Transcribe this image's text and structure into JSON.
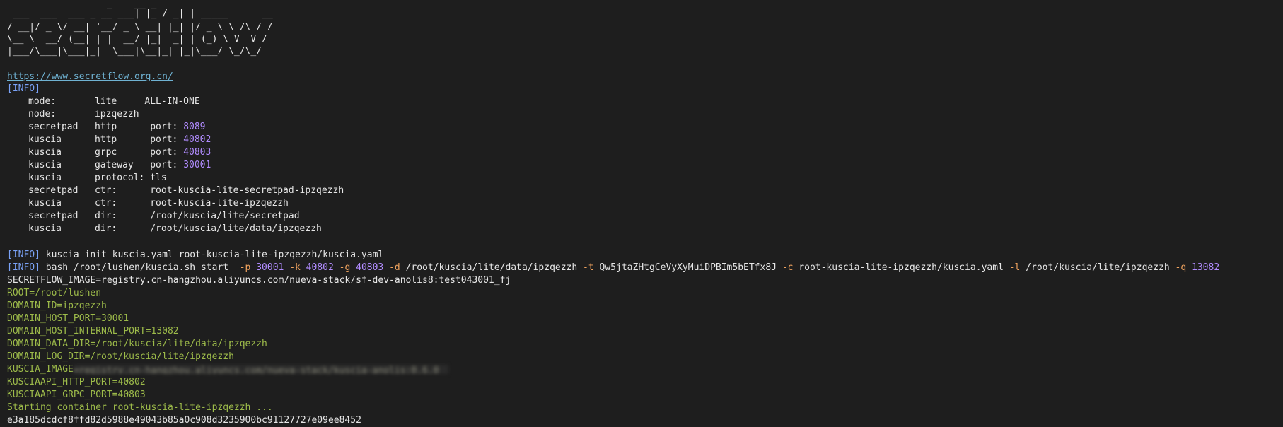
{
  "banner": [
    "                  _    __ _",
    " ___  ___  ___ _ __ ___| |_ / _| | _____      __",
    "/ __|/ _ \\/ __| '__/ _ \\ __| |_| |/ _ \\ \\ /\\ / /",
    "\\__ \\  __/ (__| | |  __/ |_|  _| | (_) \\ V  V /",
    "|___/\\___|\\___|_|  \\___|\\__|_| |_|\\___/ \\_/\\_/"
  ],
  "url": "https://www.secretflow.org.cn/",
  "info_tag": "[INFO]",
  "info_rows": [
    [
      "mode:",
      "lite",
      "ALL-IN-ONE"
    ],
    [
      "node:",
      "ipzqezzh",
      ""
    ],
    [
      "secretpad",
      "http",
      "port:",
      "8089"
    ],
    [
      "kuscia",
      "http",
      "port:",
      "40802"
    ],
    [
      "kuscia",
      "grpc",
      "port:",
      "40803"
    ],
    [
      "kuscia",
      "gateway",
      "port:",
      "30001"
    ],
    [
      "kuscia",
      "protocol:",
      "tls"
    ],
    [
      "secretpad",
      "ctr:",
      "root-kuscia-lite-secretpad-ipzqezzh"
    ],
    [
      "kuscia",
      "ctr:",
      "root-kuscia-lite-ipzqezzh"
    ],
    [
      "secretpad",
      "dir:",
      "/root/kuscia/lite/secretpad"
    ],
    [
      "kuscia",
      "dir:",
      "/root/kuscia/lite/data/ipzqezzh"
    ]
  ],
  "cmd1": "kuscia init kuscia.yaml root-kuscia-lite-ipzqezzh/kuscia.yaml",
  "cmd2": {
    "prefix": "bash /root/lushen/kuscia.sh start ",
    "p_flag": "-p",
    "p_val": "30001",
    "k_flag": "-k",
    "k_val": "40802",
    "g_flag": "-g",
    "g_val": "40803",
    "d_flag": "-d",
    "d_val": "/root/kuscia/lite/data/ipzqezzh",
    "t_flag": "-t",
    "t_val": "Qw5jtaZHtgCeVyXyMuiDPBIm5bETfx8J",
    "c_flag": "-c",
    "c_val": "root-kuscia-lite-ipzqezzh/kuscia.yaml",
    "l_flag": "-l",
    "l_val": "/root/kuscia/lite/ipzqezzh",
    "q_flag": "-q",
    "q_val": "13082"
  },
  "secretflow_image": "SECRETFLOW_IMAGE=registry.cn-hangzhou.aliyuncs.com/nueva-stack/sf-dev-anolis8:test043001_fj",
  "env_lines": [
    "ROOT=/root/lushen",
    "DOMAIN_ID=ipzqezzh",
    "DOMAIN_HOST_PORT=30001",
    "DOMAIN_HOST_INTERNAL_PORT=13082",
    "DOMAIN_DATA_DIR=/root/kuscia/lite/data/ipzqezzh",
    "DOMAIN_LOG_DIR=/root/kuscia/lite/ipzqezzh"
  ],
  "kuscia_image_label": "KUSCIA_IMAGE",
  "kuscia_image_blurred": "=registry.cn-hangzhou.aliyuncs.com/nueva-stack/kuscia-anolis:0.6.0",
  "env_lines2": [
    "KUSCIAAPI_HTTP_PORT=40802",
    "KUSCIAAPI_GRPC_PORT=40803",
    "Starting container root-kuscia-lite-ipzqezzh ..."
  ],
  "container_id": "e3a185dcdcf8ffd82d5988e49043b85a0c908d3235900bc91127727e09ee8452"
}
